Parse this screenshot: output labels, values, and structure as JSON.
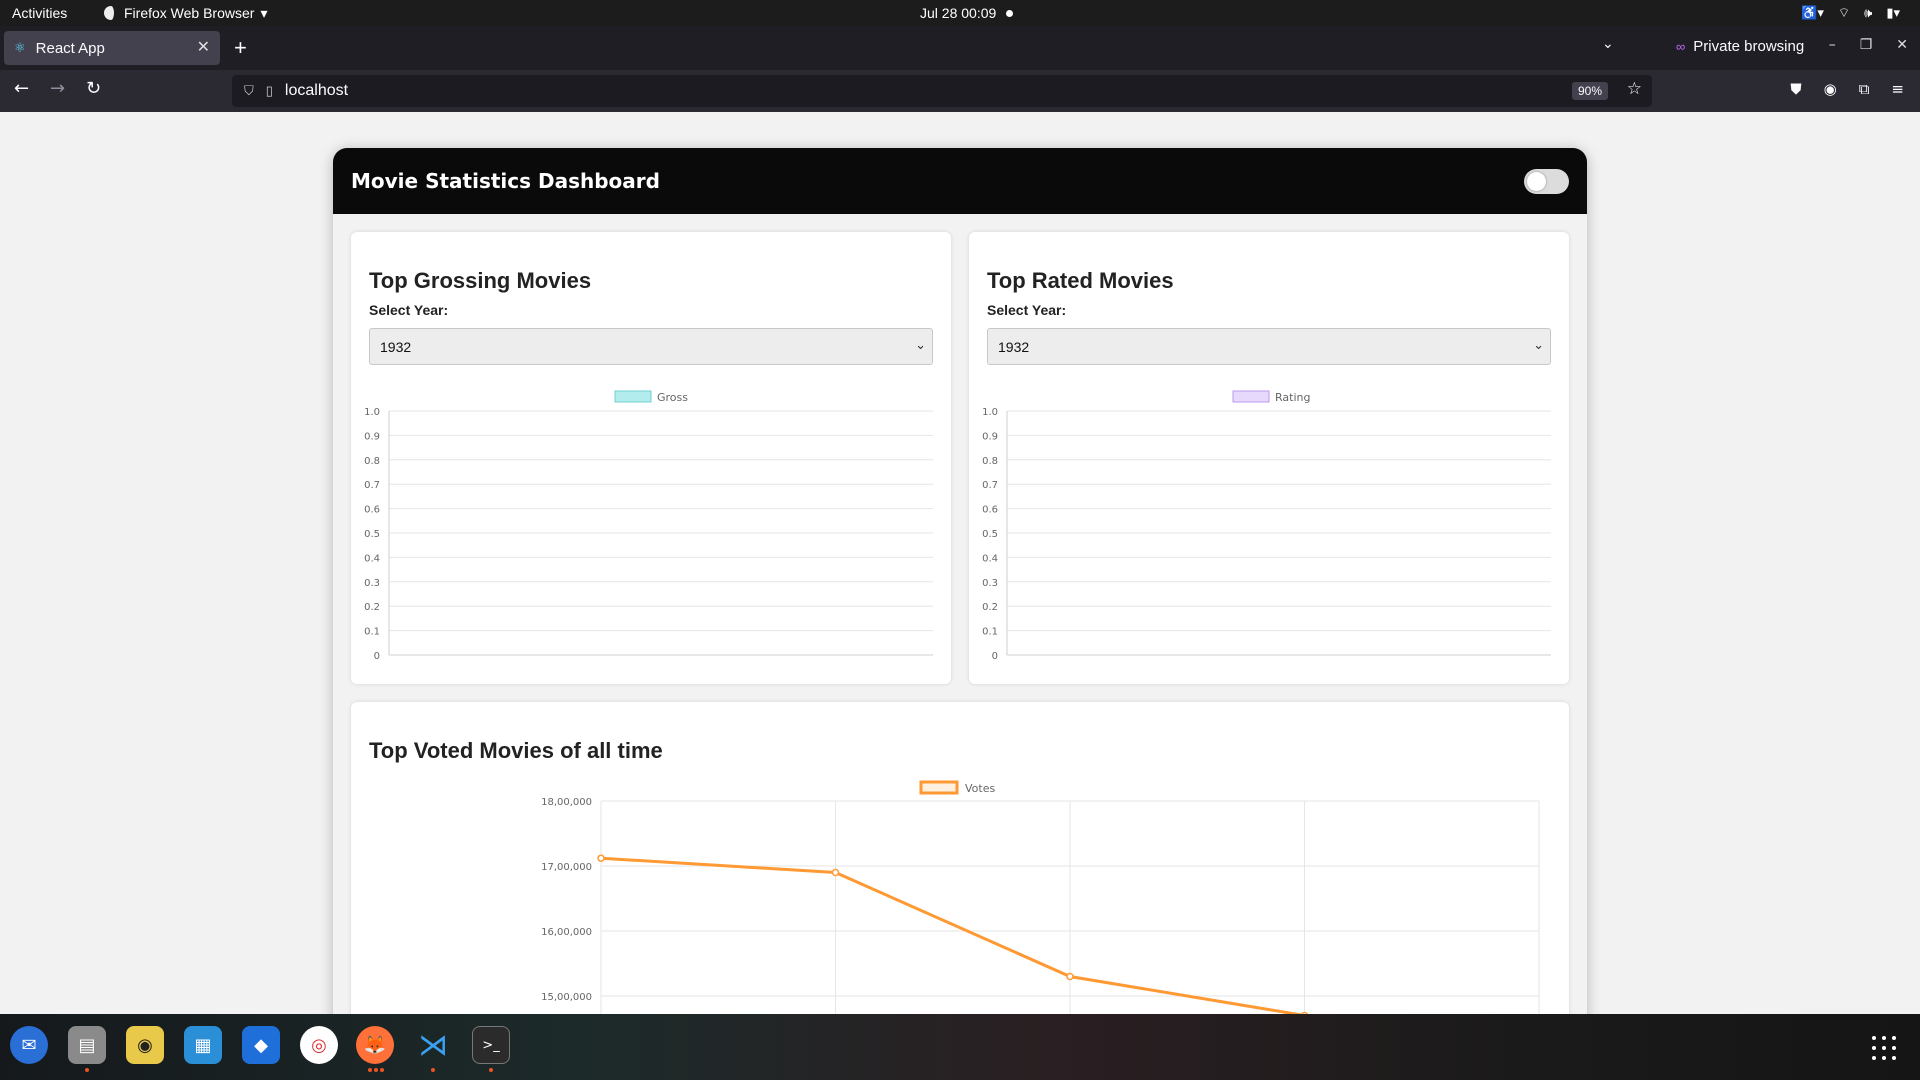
{
  "system_bar": {
    "activities": "Activities",
    "app_menu": "Firefox Web Browser",
    "clock": "Jul 28  00:09"
  },
  "browser": {
    "tab_title": "React App",
    "private_label": "Private browsing",
    "url": "localhost",
    "zoom": "90%"
  },
  "dashboard": {
    "title": "Movie Statistics Dashboard",
    "dark_mode_on": false
  },
  "gross_card": {
    "heading": "Top Grossing Movies",
    "select_label": "Select Year:",
    "selected_year": "1932"
  },
  "rated_card": {
    "heading": "Top Rated Movies",
    "select_label": "Select Year:",
    "selected_year": "1932"
  },
  "votes_card": {
    "heading": "Top Voted Movies of all time"
  },
  "chart_data": [
    {
      "type": "bar",
      "legend": "Gross",
      "legend_color": "#b3ecec",
      "legend_border": "#6fcfcf",
      "categories": [],
      "values": [],
      "ylim": [
        0,
        1.0
      ],
      "yticks": [
        "1.0",
        "0.9",
        "0.8",
        "0.7",
        "0.6",
        "0.5",
        "0.4",
        "0.3",
        "0.2",
        "0.1",
        "0"
      ],
      "grid": true,
      "legend_position": "top"
    },
    {
      "type": "bar",
      "legend": "Rating",
      "legend_color": "#e6d9fb",
      "legend_border": "#b99af2",
      "categories": [],
      "values": [],
      "ylim": [
        0,
        1.0
      ],
      "yticks": [
        "1.0",
        "0.9",
        "0.8",
        "0.7",
        "0.6",
        "0.5",
        "0.4",
        "0.3",
        "0.2",
        "0.1",
        "0"
      ],
      "grid": true,
      "legend_position": "top"
    },
    {
      "type": "line",
      "legend": "Votes",
      "color": "#ff9933",
      "yticks": [
        "18,00,000",
        "17,00,000",
        "16,00,000",
        "15,00,000"
      ],
      "ylim_visible": [
        1500000,
        1800000
      ],
      "series": [
        {
          "name": "Votes",
          "values": [
            1712000,
            1690000,
            1530000,
            1470000
          ]
        }
      ],
      "grid": true,
      "legend_position": "top"
    }
  ],
  "icons": {
    "tab_icon": "react-icon",
    "dock": [
      "thunderbird-icon",
      "files-icon",
      "rhythmbox-icon",
      "writer-icon",
      "app-icon",
      "help-icon",
      "firefox-icon",
      "vscode-icon",
      "terminal-icon",
      "app-grid-icon"
    ]
  }
}
